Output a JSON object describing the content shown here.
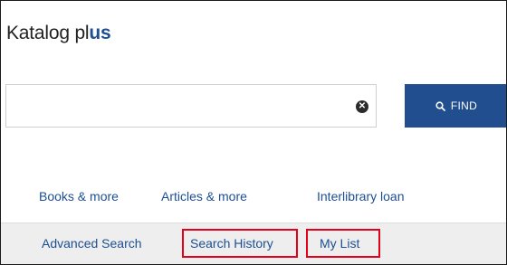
{
  "app": {
    "title_main": "Katalog pl",
    "title_accent": "us"
  },
  "search": {
    "value": "",
    "placeholder": "",
    "clear_icon": "clear-x-icon",
    "find_label": "FIND",
    "find_icon": "search-icon"
  },
  "primary_nav": [
    {
      "label": "Books & more"
    },
    {
      "label": "Articles & more"
    },
    {
      "label": "Interlibrary loan"
    }
  ],
  "secondary_nav": [
    {
      "label": "Advanced Search",
      "highlighted": false
    },
    {
      "label": "Search History",
      "highlighted": true
    },
    {
      "label": "My List",
      "highlighted": true
    }
  ],
  "colors": {
    "brand": "#214e8f",
    "link": "#1d4f91",
    "highlight_border": "#e2001a",
    "subnav_bg": "#eeeeee"
  }
}
